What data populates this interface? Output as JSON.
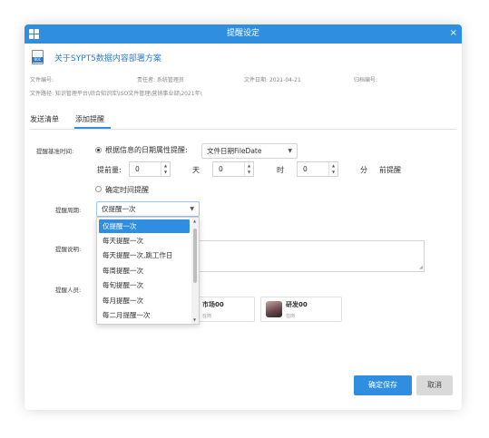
{
  "dialog": {
    "title": "提醒设定",
    "close_symbol": "×"
  },
  "document": {
    "icon_label": "DOC",
    "title": "关于SYPT5数据内容部署方案",
    "meta": {
      "file_no": "文件编号:",
      "owner": "责任者:  系统管理员",
      "date": "文件日期: 2021-04-21",
      "archive_no": "归档编号:"
    },
    "path": "文件路径:  知识管理平台\\综合知识库\\ISO文件管理\\营销事业部\\2021年\\"
  },
  "tabs": [
    {
      "label": "发送清单",
      "active": false
    },
    {
      "label": "添加提醒",
      "active": true
    }
  ],
  "form": {
    "base_time_label": "提醒基准时间:",
    "option_date_attr": "根据信息的日期属性提醒:",
    "date_attr_value": "文件日期FileDate",
    "advance_label": "提前量:",
    "days_value": "0",
    "days_unit": "天",
    "hours_value": "0",
    "hours_unit": "时",
    "minutes_value": "0",
    "minutes_unit": "分",
    "advance_suffix": "前提醒",
    "option_fixed_time": "确定时间提醒",
    "cycle_label": "提醒周期:",
    "cycle_value": "仅提醒一次",
    "cycle_options": [
      "仅提醒一次",
      "每天提醒一次",
      "每天提醒一次,跳工作日",
      "每周提醒一次",
      "每旬提醒一次",
      "每月提醒一次",
      "每二月提醒一次"
    ],
    "note_label": "提醒说明:",
    "people_label": "提醒人员:",
    "people": [
      {
        "name": "市场00",
        "status": "在岗"
      },
      {
        "name": "研发00",
        "status": "在岗"
      }
    ]
  },
  "buttons": {
    "save": "确定保存",
    "cancel": "取消"
  },
  "colors": {
    "accent": "#2f8ee0",
    "link_title": "#2c7cd1"
  }
}
